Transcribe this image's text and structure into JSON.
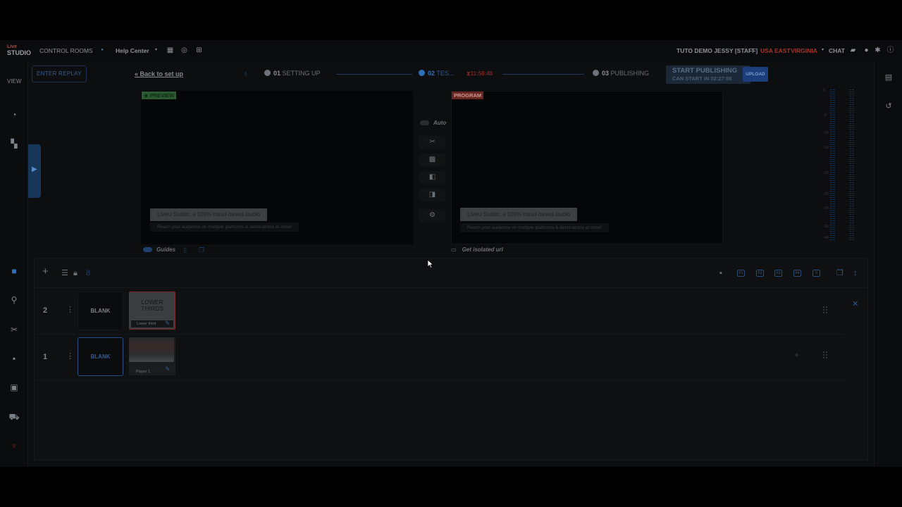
{
  "app": {
    "logo_line1": "Live",
    "logo_line2": "STUDIO"
  },
  "topbar": {
    "control_rooms": "CONTROL ROOMS",
    "help_center": "Help Center",
    "user": "TUTO DEMO JESSY [STAFF]",
    "region": "USA EAST",
    "zone": "VIRGINIA",
    "chat": "CHAT"
  },
  "leftrail": {
    "view_label": "VIEW"
  },
  "header": {
    "enter_replay": "ENTER REPLAY",
    "back_to_setup": "Back to set up",
    "step1": "SETTING UP",
    "step1_num": "01",
    "step2": "TES...",
    "step2_num": "02",
    "step2_timer": "11:58:48",
    "step3": "PUBLISHING",
    "step3_num": "03",
    "start_publishing": "START PUBLISHING",
    "start_in": "CAN START IN 02:27:58",
    "upload": "UPLOAD"
  },
  "preview": {
    "tag": "PREVIEW",
    "lower_third_title": "LiveU Studio: a 100% cloud-based studio",
    "lower_third_sub": "Reach your audience on multiple platforms & destinations at once!",
    "guides_label": "Guides"
  },
  "program": {
    "tag": "PROGRAM",
    "lower_third_title": "LiveU Studio: a 100% cloud-based studio",
    "lower_third_sub": "Reach your audience on multiple platforms & destinations at once!",
    "isolated_url": "Get isolated url"
  },
  "switcher": {
    "auto_label": "Auto"
  },
  "meter": {
    "labels": [
      "0",
      "-5",
      "-10",
      "-15",
      "-20",
      "-25",
      "-30",
      "-35",
      "-40",
      "-50",
      "-60"
    ]
  },
  "panel": {
    "layer_count": "8",
    "toolbar_shortcuts": [
      "F1",
      "F2",
      "F3",
      "F4",
      "0"
    ],
    "rows": [
      {
        "num": "2",
        "blank": "BLANK",
        "thumb_title": "LOWER THIRDS",
        "thumb_caption": "Lower third"
      },
      {
        "num": "1",
        "blank": "BLANK",
        "thumb_caption": "Player 1"
      }
    ]
  },
  "colors": {
    "accent_blue": "#2f6fb8",
    "program_red": "#6b2622",
    "preview_green": "#2a5a2f",
    "background": "#0d0e10"
  }
}
